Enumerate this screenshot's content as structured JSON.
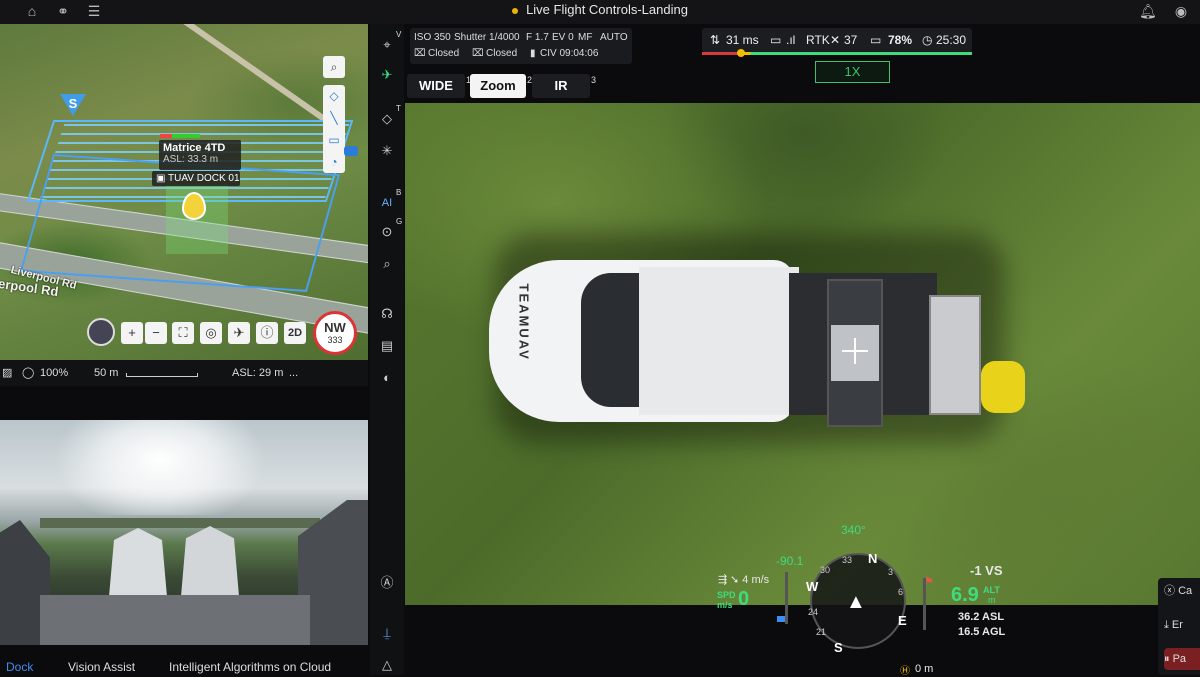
{
  "header": {
    "title": "Live Flight Controls-Landing"
  },
  "map": {
    "drone_label": "Matrice 4TD",
    "drone_asl": "ASL: 33.3 m",
    "dock_label": "TUAV DOCK 01",
    "start_marker": "S",
    "road_label_1": "Liverpool Rd",
    "road_label_2": "erpool Rd",
    "compass_dir": "NW",
    "compass_deg": "333",
    "btn_2d": "2D",
    "status": {
      "zoom": "100%",
      "scale": "50 m",
      "asl": "ASL: 29 m",
      "more": "..."
    }
  },
  "bottom_tabs": [
    {
      "label": "Dock"
    },
    {
      "label": "Vision Assist"
    },
    {
      "label": "Intelligent Algorithms on Cloud"
    }
  ],
  "toolbar": {
    "sup_v": "V",
    "sup_t": "T",
    "sup_b": "B",
    "sup_g": "G"
  },
  "camera": {
    "iso": "ISO 350",
    "shutter": "Shutter 1/4000",
    "fstop": "F 1.7",
    "ev": "EV 0",
    "focus": "MF",
    "mode": "AUTO",
    "closed1": "Closed",
    "closed2": "Closed",
    "civ": "CIV 09:04:06",
    "tabs": [
      {
        "label": "WIDE",
        "num": "1"
      },
      {
        "label": "Zoom",
        "num": "2"
      },
      {
        "label": "IR",
        "num": "3"
      }
    ],
    "zoom_level": "1X"
  },
  "status": {
    "latency": "31 ms",
    "rtk_label": "RTK",
    "rtk_sats": "37",
    "battery": "78%",
    "time": "25:30"
  },
  "hud": {
    "heading": "340",
    "pitch": "-90.1",
    "wind": "4 m/s",
    "spd_label": "SPD",
    "spd_unit": "m/s",
    "spd_value": "0",
    "vs_value": "-1 VS",
    "alt_value": "6.9",
    "alt_label": "ALT",
    "alt_unit": "m",
    "asl": "36.2 ASL",
    "agl": "16.5 AGL",
    "home_dist": "0 m",
    "compass_n": "N",
    "compass_e": "E",
    "compass_s": "S",
    "compass_w": "W",
    "compass_33": "33",
    "compass_30": "30",
    "compass_3": "3",
    "compass_6": "6",
    "compass_24": "24",
    "compass_21": "21"
  },
  "truck": {
    "brand": "TEAMUAV"
  },
  "right_panel": {
    "btn1": "Ca",
    "btn2": "Er",
    "btn3": "Pa"
  },
  "colors": {
    "accent_green": "#3fdc7c",
    "title_dot": "#f0b400",
    "flight_path": "#5ab8ff",
    "pause_red": "#d83a3a"
  }
}
